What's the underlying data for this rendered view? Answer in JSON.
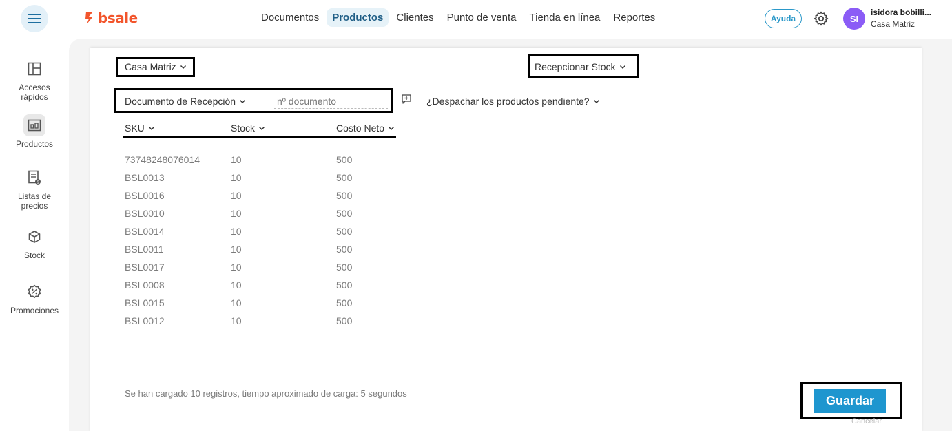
{
  "header": {
    "logo_text": "bsale",
    "brand_color": "#f2552c",
    "nav": [
      {
        "label": "Documentos",
        "active": false
      },
      {
        "label": "Productos",
        "active": true
      },
      {
        "label": "Clientes",
        "active": false
      },
      {
        "label": "Punto de venta",
        "active": false
      },
      {
        "label": "Tienda en línea",
        "active": false
      },
      {
        "label": "Reportes",
        "active": false
      }
    ],
    "help_label": "Ayuda",
    "user_initials": "SI",
    "user_name": "isidora bobilli...",
    "user_branch": "Casa Matriz"
  },
  "sidebar": {
    "items": [
      {
        "label": "Accesos rápidos",
        "icon": "layout-icon"
      },
      {
        "label": "Productos",
        "icon": "products-icon",
        "active": true
      },
      {
        "label": "Listas de precios",
        "icon": "price-list-icon"
      },
      {
        "label": "Stock",
        "icon": "cube-icon"
      },
      {
        "label": "Promociones",
        "icon": "percent-badge-icon"
      }
    ]
  },
  "form": {
    "branch_select": "Casa Matriz",
    "operation_select": "Recepcionar Stock",
    "document_type_select": "Documento de Recepción",
    "document_number_placeholder": "nº documento",
    "dispatch_question": "¿Despachar los productos pendiente?"
  },
  "table": {
    "columns": [
      "SKU",
      "Stock",
      "Costo Neto"
    ],
    "rows": [
      [
        "73748248076014",
        "10",
        "500"
      ],
      [
        "BSL0013",
        "10",
        "500"
      ],
      [
        "BSL0016",
        "10",
        "500"
      ],
      [
        "BSL0010",
        "10",
        "500"
      ],
      [
        "BSL0014",
        "10",
        "500"
      ],
      [
        "BSL0011",
        "10",
        "500"
      ],
      [
        "BSL0017",
        "10",
        "500"
      ],
      [
        "BSL0008",
        "10",
        "500"
      ],
      [
        "BSL0015",
        "10",
        "500"
      ],
      [
        "BSL0012",
        "10",
        "500"
      ]
    ]
  },
  "footer": {
    "status_text": "Se han cargado 10 registros, tiempo aproximado de carga: 5 segundos",
    "save_label": "Guardar",
    "cancel_label": "Cancelar"
  },
  "colors": {
    "accent": "#1e96cf",
    "avatar": "#8b5cf6"
  }
}
